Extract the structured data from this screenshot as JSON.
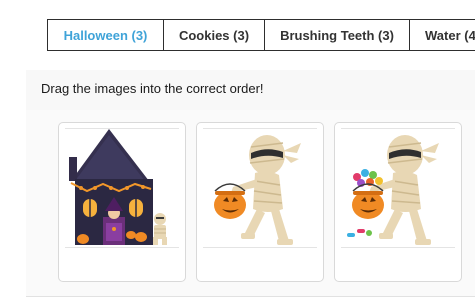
{
  "tabs": [
    {
      "label": "Halloween (3)",
      "active": true
    },
    {
      "label": "Cookies (3)",
      "active": false
    },
    {
      "label": "Brushing Teeth (3)",
      "active": false
    },
    {
      "label": "Water (4",
      "active": false
    }
  ],
  "instruction": "Drag the images into the correct order!",
  "cards": [
    {
      "icon": "haunted-house-trick-or-treat-image"
    },
    {
      "icon": "mummy-empty-pumpkin-bucket-image"
    },
    {
      "icon": "mummy-candy-pumpkin-bucket-image"
    }
  ],
  "colors": {
    "active_tab": "#3fa3d8",
    "tab_text": "#333333",
    "pumpkin": "#f08a24"
  }
}
